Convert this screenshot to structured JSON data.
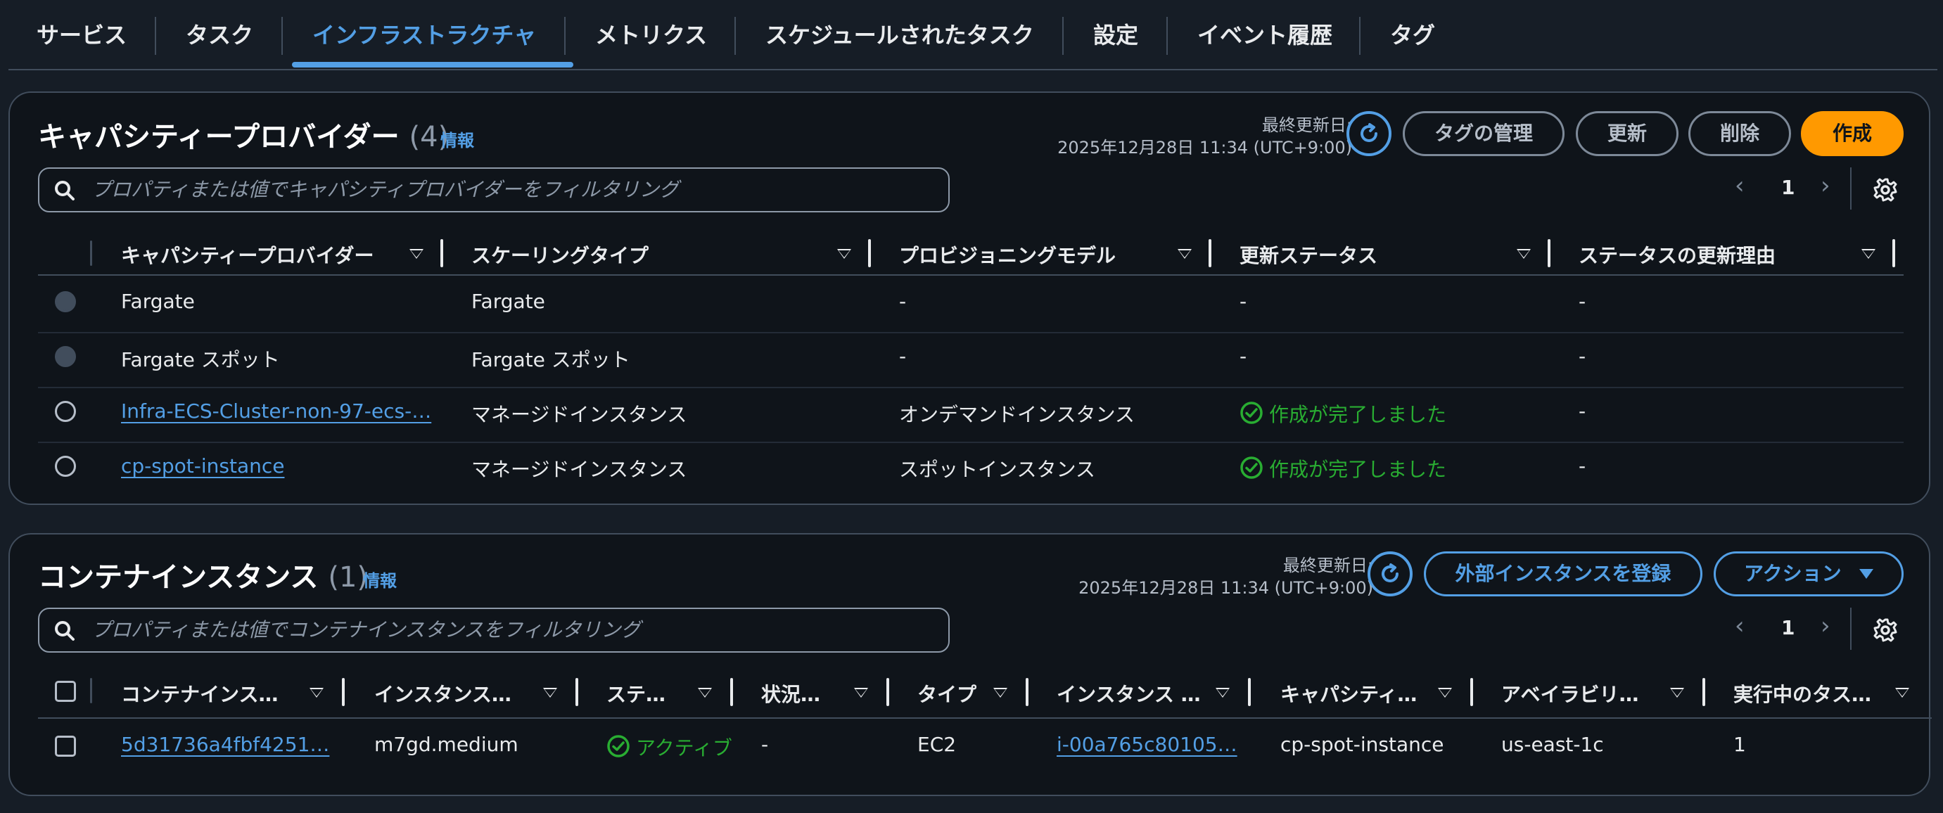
{
  "tabs": [
    {
      "label": "サービス"
    },
    {
      "label": "タスク"
    },
    {
      "label": "インフラストラクチャ"
    },
    {
      "label": "メトリクス"
    },
    {
      "label": "スケジュールされたタスク"
    },
    {
      "label": "設定"
    },
    {
      "label": "イベント履歴"
    },
    {
      "label": "タグ"
    }
  ],
  "active_tab": "インフラストラクチャ",
  "capacity_providers": {
    "title": "キャパシティープロバイダー",
    "count": "(4)",
    "info": "情報",
    "last_updated_label": "最終更新日:",
    "last_updated_value": "2025年12月28日 11:34 (UTC+9:00)",
    "buttons": {
      "manage_tags": "タグの管理",
      "refresh": "更新",
      "delete": "削除",
      "create": "作成"
    },
    "filter_placeholder": "プロパティまたは値でキャパシティプロバイダーをフィルタリング",
    "page": "1",
    "columns": [
      "キャパシティープロバイダー",
      "スケーリングタイプ",
      "プロビジョニングモデル",
      "更新ステータス",
      "ステータスの更新理由"
    ],
    "rows": [
      {
        "name": "Fargate",
        "scaling": "Fargate",
        "model": "-",
        "status": "-",
        "reason": "-"
      },
      {
        "name": "Fargate スポット",
        "scaling": "Fargate スポット",
        "model": "-",
        "status": "-",
        "reason": "-"
      },
      {
        "name": "Infra-ECS-Cluster-non-97-ecs-…",
        "scaling": "マネージドインスタンス",
        "model": "オンデマンドインスタンス",
        "status": "作成が完了しました",
        "reason": "-"
      },
      {
        "name": "cp-spot-instance",
        "scaling": "マネージドインスタンス",
        "model": "スポットインスタンス",
        "status": "作成が完了しました",
        "reason": "-"
      }
    ]
  },
  "container_instances": {
    "title": "コンテナインスタンス",
    "count": "(1)",
    "info": "情報",
    "last_updated_label": "最終更新日:",
    "last_updated_value": "2025年12月28日 11:34 (UTC+9:00)",
    "buttons": {
      "register_external": "外部インスタンスを登録",
      "actions": "アクション"
    },
    "filter_placeholder": "プロパティまたは値でコンテナインスタンスをフィルタリング",
    "page": "1",
    "columns": [
      "コンテナインス…",
      "インスタンス…",
      "ステ…",
      "状況…",
      "タイプ",
      "インスタンス …",
      "キャパシティ…",
      "アベイラビリ…",
      "実行中のタス…"
    ],
    "rows": [
      {
        "id": "5d31736a4fbf4251…",
        "instance_type": "m7gd.medium",
        "status": "アクティブ",
        "state": "-",
        "type": "EC2",
        "instance_id": "i-00a765c80105…",
        "capacity_provider": "cp-spot-instance",
        "az": "us-east-1c",
        "running": "1"
      }
    ]
  },
  "colors": {
    "accent": "#539fe5",
    "primary": "#ff9900",
    "success": "#29ad32",
    "background": "#0f141a"
  }
}
